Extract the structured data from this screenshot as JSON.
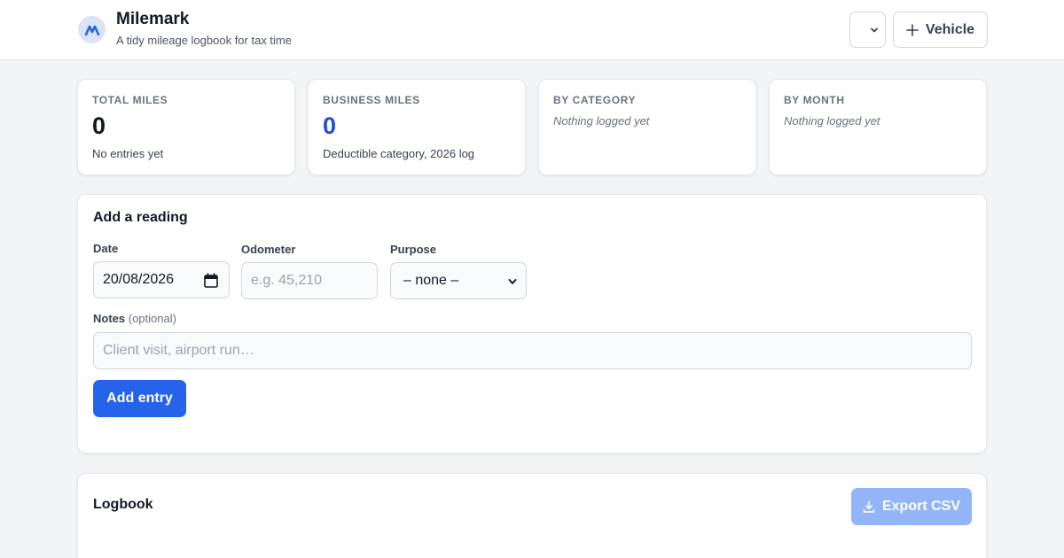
{
  "app": {
    "name": "Milemark",
    "tagline": "A tidy mileage logbook for tax time"
  },
  "header": {
    "vehicle_select_value": "",
    "add_vehicle_label": "Vehicle"
  },
  "stats": {
    "total_miles": {
      "label": "TOTAL MILES",
      "value": "0",
      "caption": "No entries yet"
    },
    "business_miles": {
      "label": "BUSINESS MILES",
      "value": "0",
      "caption": "Deductible category, 2026 log"
    },
    "by_category": {
      "label": "BY CATEGORY",
      "empty": "Nothing logged yet"
    },
    "by_month": {
      "label": "BY MONTH",
      "empty": "Nothing logged yet"
    }
  },
  "form": {
    "title": "Add a reading",
    "date_label": "Date",
    "date_value": "20/08/2026",
    "odometer_label": "Odometer",
    "odometer_placeholder": "e.g. 45,210",
    "purpose_label": "Purpose",
    "purpose_value": "– none –",
    "notes_label": "Notes",
    "notes_optional": "(optional)",
    "notes_placeholder": "Client visit, airport run…",
    "submit_label": "Add entry"
  },
  "logbook": {
    "title": "Logbook",
    "export_label": "Export CSV"
  },
  "colors": {
    "accent": "#2563eb",
    "accent_disabled": "#93b4f7",
    "business_value": "#1d4ed8"
  },
  "icons": {
    "logo": "milemark-logo-icon",
    "vehicle_dropdown": "chevron-down-icon",
    "add": "plus-icon",
    "calendar": "calendar-icon",
    "purpose_dropdown": "chevron-down-icon",
    "export": "download-icon"
  }
}
